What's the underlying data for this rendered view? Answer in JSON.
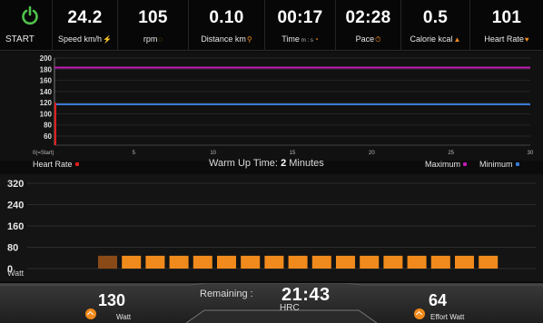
{
  "stats": {
    "start_label": "START",
    "speed": {
      "value": "24.2",
      "label": "Speed km/h"
    },
    "rpm": {
      "value": "105",
      "label": "rpm"
    },
    "distance": {
      "value": "0.10",
      "label": "Distance km"
    },
    "time": {
      "value": "00:17",
      "label": "Time",
      "sub": "m : s"
    },
    "pace": {
      "value": "02:28",
      "label": "Pace"
    },
    "calorie": {
      "value": "0.5",
      "label": "Calorie kcal"
    },
    "heart_rate": {
      "value": "101",
      "label": "Heart Rate"
    }
  },
  "legend": {
    "heart_rate": "Heart Rate",
    "warm_up_prefix": "Warm Up Time:",
    "warm_up_value": "2",
    "warm_up_suffix": "Minutes",
    "maximum": "Maximum",
    "minimum": "Minimum"
  },
  "bottom_bar": {
    "watt_value": "130",
    "watt_label": "Watt",
    "remaining_label": "Remaining :",
    "remaining_value": "21:43",
    "program": "HRC",
    "effort_value": "64",
    "effort_label": "Effort Watt"
  },
  "colors": {
    "accent": "#f08a1c",
    "power_icon": "#4fc24a",
    "heart_rate": "#e01e1e",
    "maximum": "#c21bb8",
    "minimum": "#3a78d8",
    "bar_current": "#8a4a18",
    "bar": "#f08a1c"
  },
  "chart_data": [
    {
      "type": "line",
      "y_ticks": [
        "200",
        "180",
        "160",
        "140",
        "120",
        "100",
        "80",
        "60"
      ],
      "x_ticks": [
        "0",
        "5",
        "10",
        "15",
        "20",
        "25",
        "30"
      ],
      "x_start_label": "0(=Start)",
      "ylim": [
        60,
        200
      ],
      "xlim": [
        0,
        30
      ],
      "series": [
        {
          "name": "Maximum",
          "color": "#c21bb8",
          "x": [
            0,
            30
          ],
          "y": [
            183,
            183
          ]
        },
        {
          "name": "Minimum",
          "color": "#3a78d8",
          "x": [
            0,
            30
          ],
          "y": [
            117,
            117
          ]
        }
      ]
    },
    {
      "type": "bar",
      "y_ticks": [
        "320",
        "240",
        "160",
        "80",
        "0"
      ],
      "ylim": [
        0,
        320
      ],
      "ylabel": "Watt",
      "values": [
        48,
        48,
        48,
        48,
        48,
        48,
        48,
        48,
        48,
        48,
        48,
        48,
        48,
        48,
        48,
        48,
        48
      ],
      "current_index": 0
    }
  ]
}
